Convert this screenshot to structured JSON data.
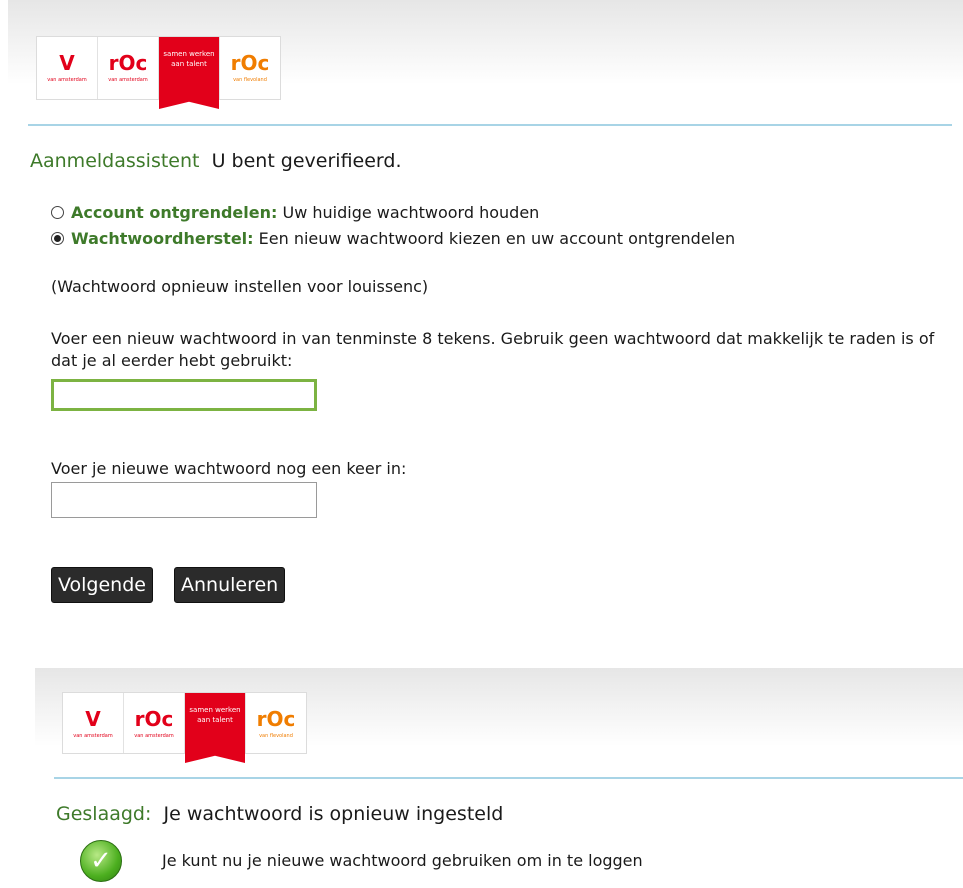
{
  "logo": {
    "tiles": [
      {
        "mark": "V",
        "sub": "van amsterdam"
      },
      {
        "mark": "rOc",
        "sub": "van amsterdam"
      },
      {
        "lines": "samen werken aan talent"
      },
      {
        "mark": "rOc",
        "sub": "van flevoland"
      }
    ]
  },
  "form": {
    "title_label": "Aanmeldassistent",
    "title_text": "U bent geverifieerd.",
    "options": [
      {
        "label": "Account ontgrendelen:",
        "text": "Uw huidige wachtwoord houden",
        "selected": false
      },
      {
        "label": "Wachtwoordherstel:",
        "text": "Een nieuw wachtwoord kiezen en uw account ontgrendelen",
        "selected": true
      }
    ],
    "reset_note": "(Wachtwoord opnieuw instellen voor louissenc)",
    "password_instruction": "Voer een nieuw wachtwoord in van tenminste 8 tekens. Gebruik geen wachtwoord dat makkelijk te raden is of dat je al eerder hebt gebruikt:",
    "password_value": "",
    "confirm_label": "Voer je nieuwe wachtwoord nog een keer in:",
    "confirm_value": "",
    "next_button": "Volgende",
    "cancel_button": "Annuleren"
  },
  "success": {
    "title_label": "Geslaagd:",
    "title_text": "Je wachtwoord is opnieuw ingesteld",
    "message": "Je kunt nu je nieuwe wachtwoord gebruiken om in te loggen"
  },
  "colors": {
    "accent_green": "#3e7a2a",
    "brand_red": "#e2001a",
    "brand_orange": "#f07d00",
    "rule_blue": "#a8d4e6"
  }
}
